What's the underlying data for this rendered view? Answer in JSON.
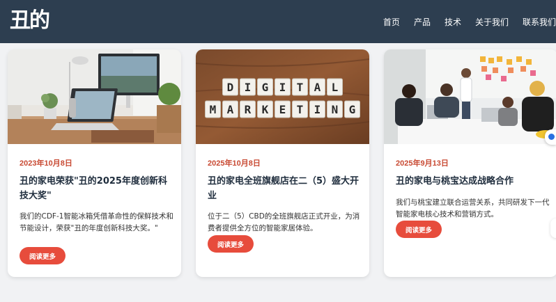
{
  "brand": {
    "logo_text": "丑的"
  },
  "nav": {
    "items": [
      {
        "label": "首页"
      },
      {
        "label": "产品"
      },
      {
        "label": "技术"
      },
      {
        "label": "关于我们"
      },
      {
        "label": "联系我们"
      }
    ]
  },
  "cards": [
    {
      "image_alt": "workspace-laptop-image",
      "date": "2023年10月8日",
      "title": "丑的家电荣获\"丑的2025年度创新科技大奖\"",
      "description": "我们的CDF-1智能冰箱凭借革命性的保鲜技术和节能设计，荣获\"丑的年度创新科技大奖。\"",
      "button": "阅读更多"
    },
    {
      "image_alt": "digital-marketing-tiles-image",
      "image_words": [
        "DIGITAL",
        "MARKETING"
      ],
      "date": "2025年10月8日",
      "title": "丑的家电全班旗舰店在二（5）盛大开业",
      "description": "位于二（5）CBD的全班旗舰店正式开业，为消费者提供全方位的智能家居体验。",
      "button": "阅读更多"
    },
    {
      "image_alt": "team-meeting-image",
      "date": "2025年9月13日",
      "title": "丑的家电与桃宝达成战略合作",
      "description": "我们与桃宝建立联合运营关系，共同研发下一代智能家电核心技术和营销方式。",
      "button": "阅读更多"
    }
  ],
  "colors": {
    "header_bg": "#2d3e50",
    "accent": "#e74c3c",
    "date": "#c84a33",
    "page_bg": "#f1f2f4"
  }
}
